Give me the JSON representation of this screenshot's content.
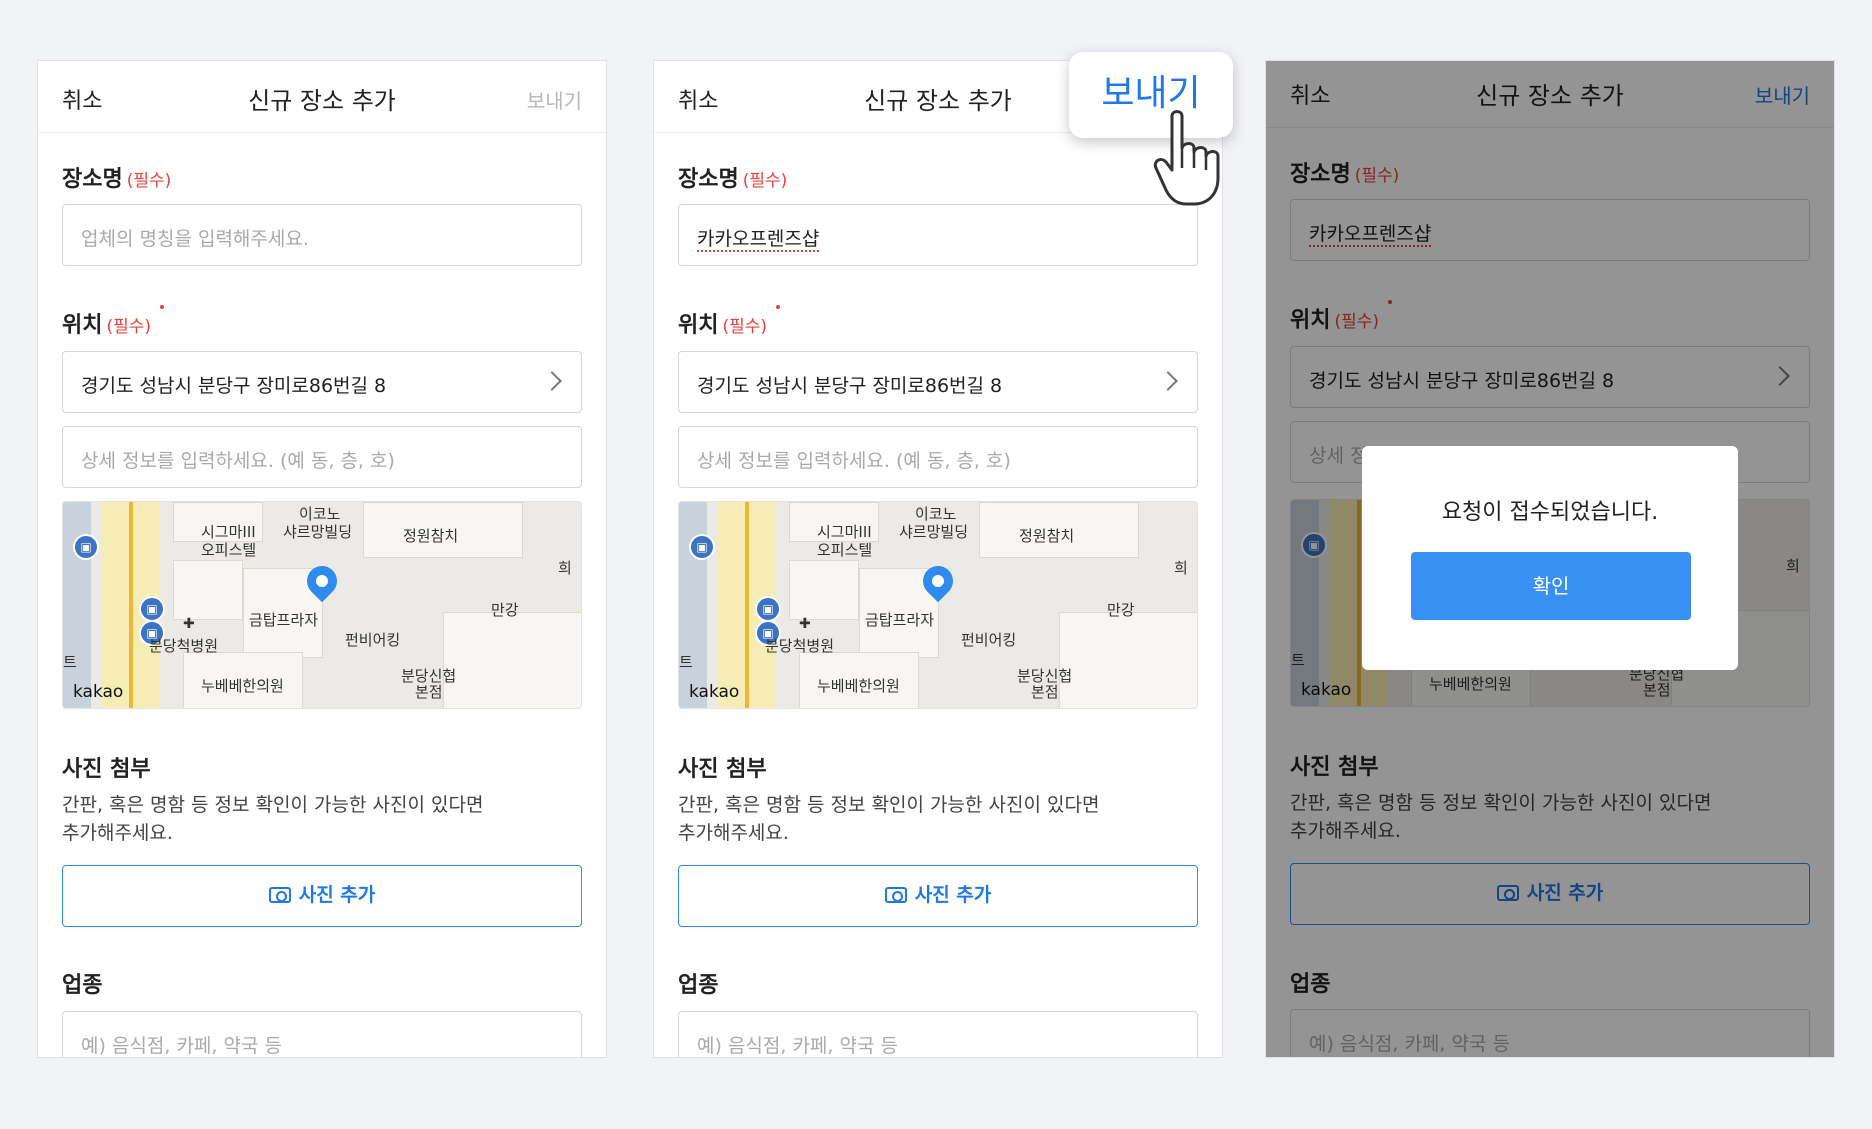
{
  "nav": {
    "cancel": "취소",
    "title": "신규 장소 추가",
    "send": "보내기"
  },
  "form": {
    "name_label": "장소명",
    "required": "(필수)",
    "name_placeholder": "업체의 명칭을 입력해주세요.",
    "name_value": "카카오프렌즈샵",
    "location_label": "위치",
    "address": "경기도 성남시 분당구 장미로86번길 8",
    "detail_placeholder": "상세 정보를 입력하세요. (예 동, 층, 호)",
    "photo_label": "사진 첨부",
    "photo_desc_line1": "간판, 혹은 명함 등 정보 확인이 가능한 사진이 있다면",
    "photo_desc_line2": "추가해주세요.",
    "photo_button": "사진 추가",
    "category_label": "업종",
    "category_placeholder": "예) 음식점, 카페, 약국 등"
  },
  "map": {
    "labels": [
      "이코노",
      "시그마III",
      "오피스텔",
      "샤르망빌딩",
      "정원참치",
      "희",
      "만강",
      "금탑프라자",
      "펀비어킹",
      "분당척병원",
      "누베베한의원",
      "분당신협",
      "본점",
      "트"
    ],
    "logo": "kakao"
  },
  "dialog": {
    "message": "요청이 접수되었습니다.",
    "confirm": "확인"
  },
  "colors": {
    "accent": "#1e78e6",
    "required": "#e9413c",
    "confirm_button": "#3891f2"
  }
}
